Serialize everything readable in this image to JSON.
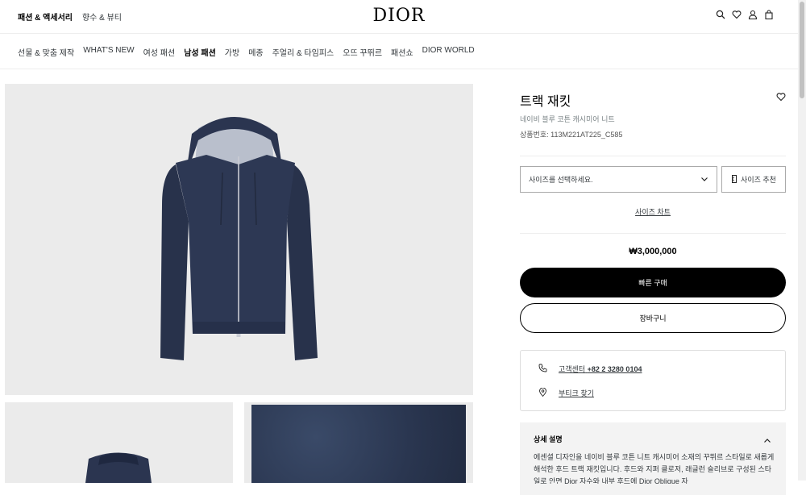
{
  "header": {
    "top_tabs": [
      "패션 & 액세서리",
      "향수 & 뷰티"
    ],
    "logo": "DIOR",
    "icons": [
      "search-icon",
      "heart-icon",
      "user-icon",
      "bag-icon"
    ]
  },
  "nav": {
    "items": [
      "선물 & 맞춤 제작",
      "WHAT'S NEW",
      "여성 패션",
      "남성 패션",
      "가방",
      "메종",
      "주얼리 & 타임피스",
      "오뜨 꾸뛰르",
      "패션쇼",
      "DIOR WORLD"
    ],
    "active_index": 3
  },
  "product": {
    "title": "트랙 재킷",
    "subtitle": "네이비 블루 코튼 캐시미어 니트",
    "sku": "상품번호: 113M221AT225_C585",
    "size_placeholder": "사이즈를 선택하세요.",
    "size_recommend": "사이즈 추천",
    "size_chart": "사이즈 차트",
    "price": "₩3,000,000",
    "buy_now": "빠른 구매",
    "add_to_cart": "장바구니"
  },
  "contact": {
    "phone_label": "고객센터",
    "phone_number": "+82 2 3280 0104",
    "store_label": "부티크 찾기"
  },
  "details": {
    "heading": "상세 설명",
    "text": "에센셜 디자인을 네이비 블루 코튼 니트 캐시미어 소재의 꾸뛰르 스타일로 새롭게 해석한 후드 트랙 재킷입니다. 후드와 지퍼 클로저, 래글런 슬리브로 구성된 스타일로 안면 Dior 자수와 내부 후드에 Dior Oblique 자"
  },
  "colors": {
    "navy": "#2b3550",
    "button_black": "#000000",
    "panel_gray": "#ebebeb"
  }
}
